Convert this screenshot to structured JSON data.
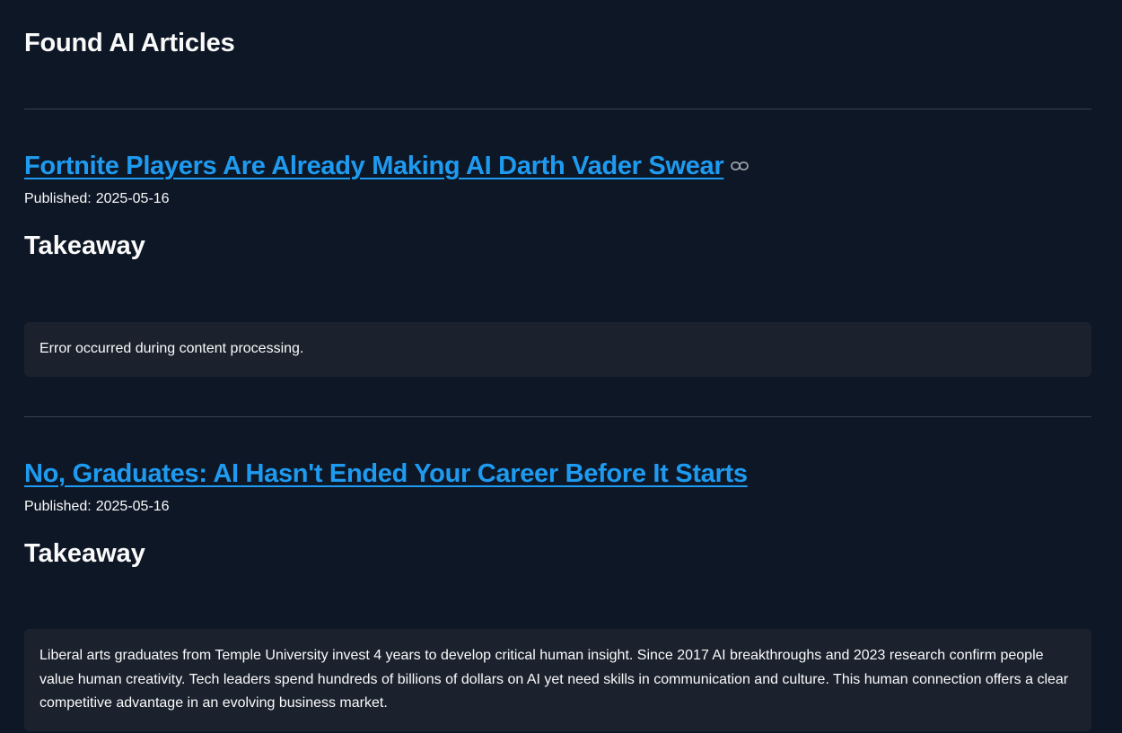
{
  "page": {
    "title": "Found AI Articles"
  },
  "articles": [
    {
      "title": "Fortnite Players Are Already Making AI Darth Vader Swear",
      "published_label": "Published:",
      "published_date": "2025-05-16",
      "takeaway_heading": "Takeaway",
      "takeaway_text": "Error occurred during content processing.",
      "has_link_icon": true,
      "link_icon": "link-icon"
    },
    {
      "title": "No, Graduates: AI Hasn't Ended Your Career Before It Starts",
      "published_label": "Published:",
      "published_date": "2025-05-16",
      "takeaway_heading": "Takeaway",
      "takeaway_text": "Liberal arts graduates from Temple University invest 4 years to develop critical human insight. Since 2017 AI breakthroughs and 2023 research confirm people value human creativity. Tech leaders spend hundreds of billions of dollars on AI yet need skills in communication and culture. This human connection offers a clear competitive advantage in an evolving business market.",
      "has_link_icon": false
    }
  ],
  "colors": {
    "background": "#0e1726",
    "link": "#1e9bf0",
    "text": "#fafafa",
    "card": "#1b222e",
    "divider": "#3a404c"
  }
}
